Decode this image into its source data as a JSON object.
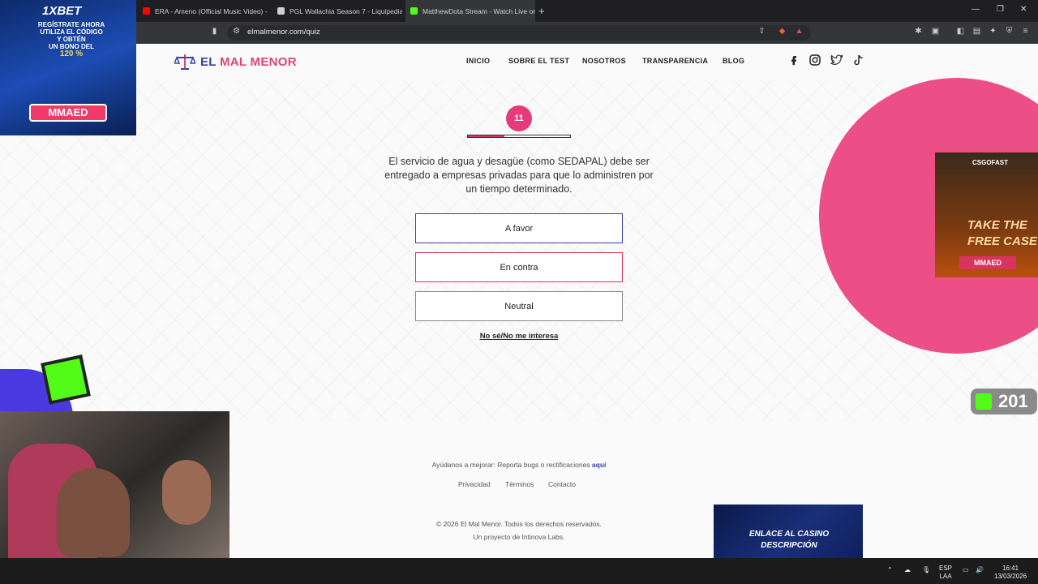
{
  "browser": {
    "tabs": [
      {
        "title": "ERA - Ameno (Official Music Video) -",
        "fav_color": "#ff0000"
      },
      {
        "title": "PGL Wallachia Season 7 - Liquipedia",
        "fav_color": "#cfcfcf"
      },
      {
        "title": "MatthewDota Stream - Watch Live on",
        "fav_color": "#53fc18"
      }
    ],
    "url": "elmalmenor.com/quiz"
  },
  "site": {
    "logo_first": "EL ",
    "logo_second": "MAL MENOR",
    "nav": [
      "INICIO",
      "SOBRE EL TEST",
      "NOSOTROS",
      "TRANSPARENCIA",
      "BLOG"
    ]
  },
  "quiz": {
    "step": "11",
    "progress": 0.36,
    "question": "El servicio de agua y desagüe (como SEDAPAL) debe ser entregado a empresas privadas para que lo administren por un tiempo determinado.",
    "options": [
      "A favor",
      "En contra",
      "Neutral"
    ],
    "skip": "No sé/No me interesa"
  },
  "footer": {
    "help_text": "Ayúdanos a mejorar: Reporta bugs o rectificaciones ",
    "help_link": "aquí",
    "links": [
      "Privacidad",
      "Términos",
      "Contacto"
    ],
    "copyright": "© 2026 El Mal Menor. Todos los derechos reservados.",
    "credit": "Un proyecto de Intinova Labs."
  },
  "overlays": {
    "ad_left": {
      "brand": "1XBET",
      "line1": "REGÍSTRATE AHORA",
      "line2": "UTILIZA EL CÓDIGO",
      "line3": "Y OBTÉN",
      "line4": "UN BONO DEL",
      "line5": "120 %",
      "code": "MMAED"
    },
    "ad_right": {
      "brand": "CSGOFAST",
      "tag1": "TAKE THE",
      "tag2": "FREE CASE",
      "code": "MMAED"
    },
    "kick_count": "201",
    "ad_casino": {
      "line1": "ENLACE AL CASINO",
      "line2": "DESCRIPCIÓN"
    }
  },
  "taskbar": {
    "lang1": "ESP",
    "lang2": "LAA",
    "time": "16:41",
    "date": "13/03/2026"
  }
}
